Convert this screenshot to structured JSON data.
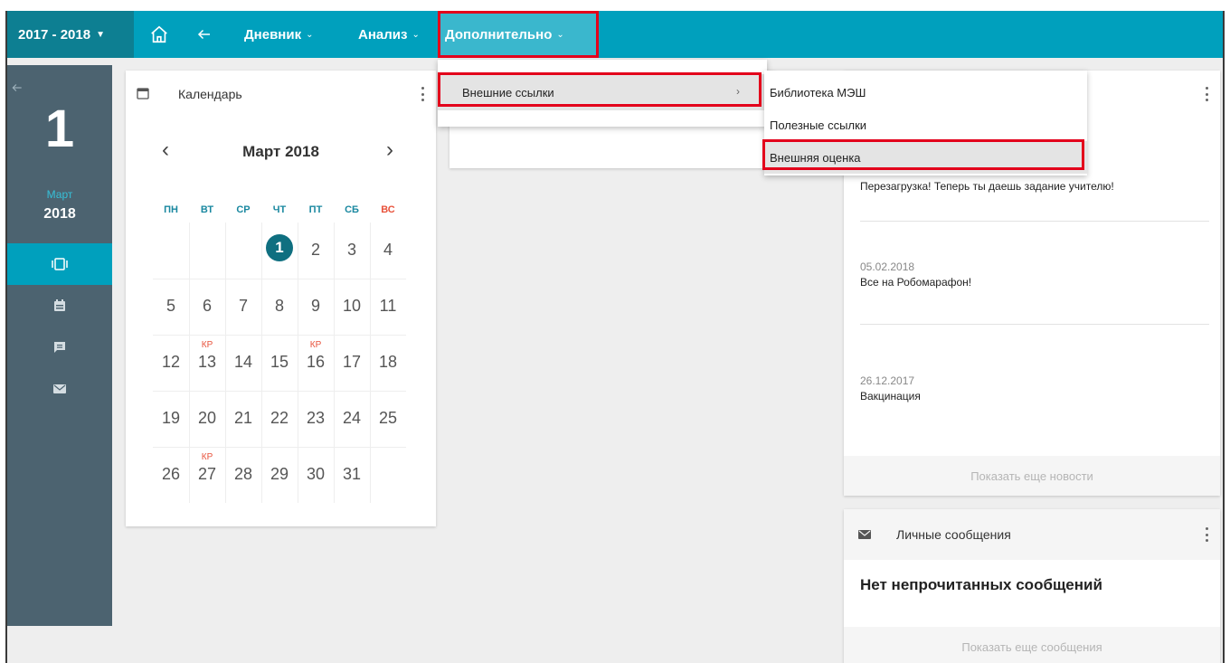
{
  "topbar": {
    "year": "2017 - 2018",
    "nav_diary": "Дневник",
    "nav_analysis": "Анализ",
    "nav_extra": "Дополнительно"
  },
  "rail": {
    "day": "1",
    "month": "Март",
    "year": "2018"
  },
  "calendar": {
    "header": "Календарь",
    "month_title": "Март 2018",
    "weekdays": [
      "ПН",
      "ВТ",
      "СР",
      "ЧТ",
      "ПТ",
      "СБ",
      "ВС"
    ],
    "rows": [
      [
        "",
        "",
        "",
        "1",
        "2",
        "3",
        "4"
      ],
      [
        "5",
        "6",
        "7",
        "8",
        "9",
        "10",
        "11"
      ],
      [
        "12",
        "13",
        "14",
        "15",
        "16",
        "17",
        "18"
      ],
      [
        "19",
        "20",
        "21",
        "22",
        "23",
        "24",
        "25"
      ],
      [
        "26",
        "27",
        "28",
        "29",
        "30",
        "31",
        ""
      ]
    ],
    "kr_label": "КР",
    "kr_days": [
      "13",
      "16",
      "27"
    ],
    "today": "1"
  },
  "dropdown": {
    "item_external_links": "Внешние ссылки",
    "arrow": "›"
  },
  "submenu": {
    "items": [
      "Библиотека МЭШ",
      "Полезные ссылки",
      "Внешняя оценка"
    ],
    "highlighted": "Внешняя оценка"
  },
  "news": {
    "entries": [
      {
        "date": "",
        "text": "Перезагрузка! Теперь ты даешь задание учителю!"
      },
      {
        "date": "05.02.2018",
        "text": "Все на Робомарафон!"
      },
      {
        "date": "26.12.2017",
        "text": "Вакцинация"
      }
    ],
    "more": "Показать еще новости"
  },
  "messages": {
    "title": "Личные сообщения",
    "empty": "Нет непрочитанных сообщений",
    "more": "Показать еще сообщения"
  },
  "colors": {
    "topbar": "#00a0bd",
    "year_select": "#0d7f92",
    "rail": "#4c6370",
    "accent_red": "#e3001b",
    "weekend": "#e8533c",
    "today": "#0f6f80"
  }
}
